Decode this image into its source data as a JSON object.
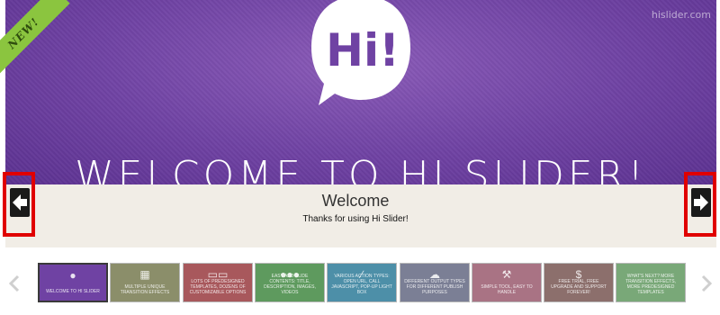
{
  "slider": {
    "watermark": "hislider.com",
    "ribbon": "NEW!",
    "logo_text": "Hi!",
    "headline": "WELCOME TO HI SLIDER!",
    "caption_title": "Welcome",
    "caption_text": "Thanks for using Hi Slider!"
  },
  "thumbnails": [
    {
      "label": "WELCOME TO HI SLIDER",
      "icon": "hi-logo-icon",
      "color": "#6f42a3"
    },
    {
      "label": "MULTIPLE UNIQUE TRANSITION EFFECTS",
      "icon": "grid-icon",
      "color": "#8b8e6a"
    },
    {
      "label": "LOTS OF PREDESIGNED TEMPLATES, DOZENS OF CUSTOMIZABLE OPTIONS",
      "icon": "templates-icon",
      "color": "#a8585c"
    },
    {
      "label": "EASY ADD SLIDE CONTENTS: TITLE, DESCRIPTION, IMAGES, VIDEOS",
      "icon": "media-icons",
      "color": "#5e9a5e"
    },
    {
      "label": "VARIOUS ACTION TYPES: OPEN URL, CALL JAVASCRIPT, POP-UP LIGHT BOX",
      "icon": "link-icon",
      "color": "#4d8fa8"
    },
    {
      "label": "DIFFERENT OUTPUT TYPES FOR DIFFERENT PUBLISH PURPOSES",
      "icon": "cloud-upload-icon",
      "color": "#7b7f95"
    },
    {
      "label": "SIMPLE TOOL, EASY TO HANDLE",
      "icon": "tools-icon",
      "color": "#a97384"
    },
    {
      "label": "FREE TRIAL, FREE UPGRADE AND SUPPORT FOREVER!",
      "icon": "dollar-icon",
      "color": "#8c6f6c"
    },
    {
      "label": "WHAT'S NEXT? MORE TRANSITION EFFECTS, MORE PREDESIGNED TEMPLATES",
      "icon": "none",
      "color": "#79a878"
    }
  ],
  "colors": {
    "nav_highlight": "#e00000",
    "ribbon": "#8bc53f",
    "slide_bg": "#6f42a3",
    "caption_bg": "#f1ede6"
  }
}
